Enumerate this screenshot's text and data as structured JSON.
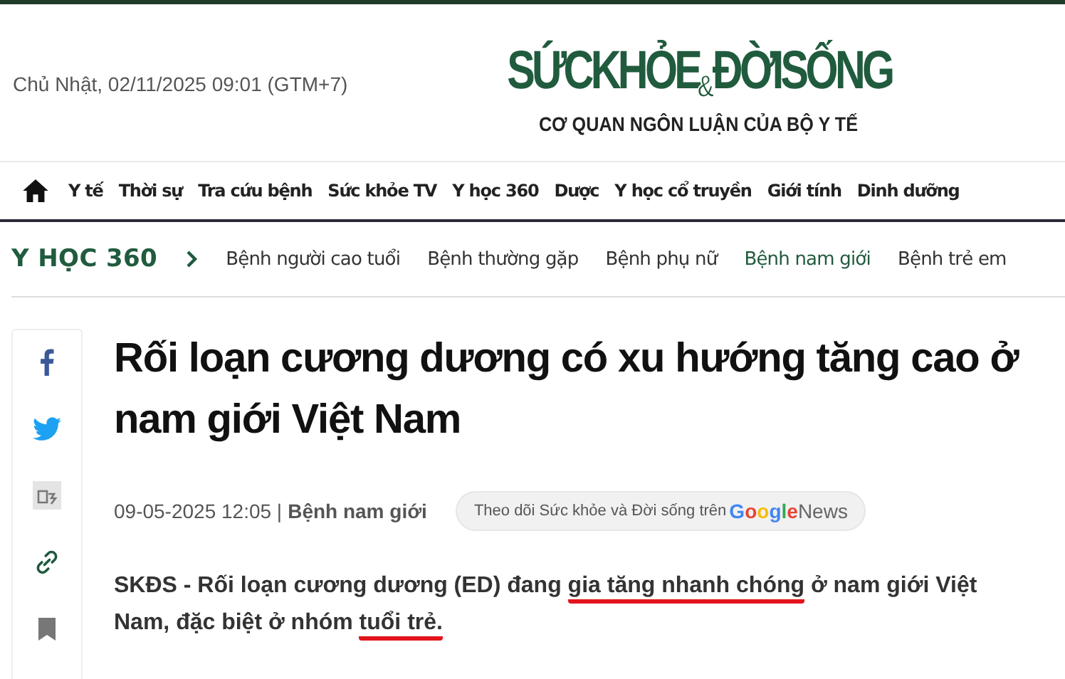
{
  "header": {
    "date": "Chủ Nhật, 02/11/2025 09:01 (GTM+7)",
    "logo": {
      "parts": [
        "SỨCKHỎE",
        "&",
        "ĐỜISỐNG"
      ],
      "tagline": "CƠ QUAN NGÔN LUẬN CỦA BỘ Y TẾ"
    }
  },
  "nav": [
    "Y tế",
    "Thời sự",
    "Tra cứu bệnh",
    "Sức khỏe TV",
    "Y học 360",
    "Dược",
    "Y học cổ truyền",
    "Giới tính",
    "Dinh dưỡng"
  ],
  "breadcrumb": {
    "section": "Y HỌC 360",
    "items": [
      {
        "label": "Bệnh người cao tuổi",
        "selected": false
      },
      {
        "label": "Bệnh thường gặp",
        "selected": false
      },
      {
        "label": "Bệnh phụ nữ",
        "selected": false
      },
      {
        "label": "Bệnh nam giới",
        "selected": true
      },
      {
        "label": "Bệnh trẻ em",
        "selected": false
      }
    ]
  },
  "share": [
    {
      "kind": "facebook"
    },
    {
      "kind": "twitter"
    },
    {
      "kind": "image"
    },
    {
      "kind": "link"
    },
    {
      "kind": "bookmark"
    }
  ],
  "article": {
    "title": "Rối loạn cương dương có xu hướng tăng cao ở nam giới Việt Nam",
    "date": "09-05-2025 12:05 |",
    "category": "Bệnh nam giới",
    "follow": {
      "text": "Theo dõi Sức khỏe và Đời sống trên",
      "brand": "Google",
      "product": "News"
    },
    "lead": [
      {
        "text": "SKĐS - Rối loạn cương dương (ED) đang ",
        "underlined": false
      },
      {
        "text": "gia tăng nhanh chóng",
        "underlined": true
      },
      {
        "text": " ở nam giới Việt Nam, đặc biệt ở nhóm ",
        "underlined": false
      },
      {
        "text": "tuổi trẻ.",
        "underlined": true
      }
    ]
  }
}
